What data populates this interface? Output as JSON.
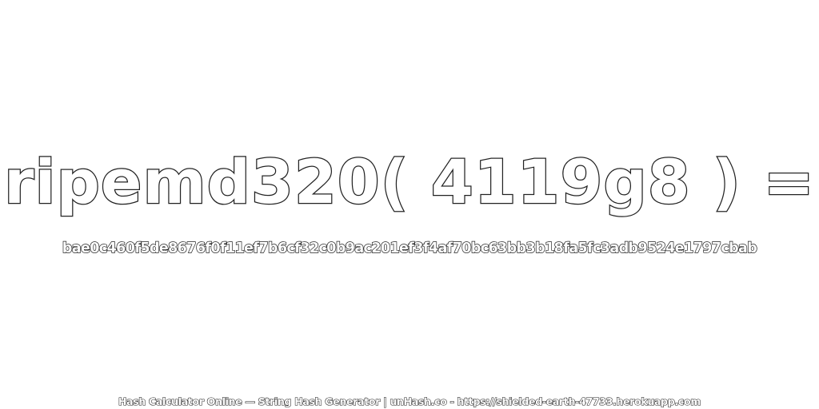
{
  "title": "ripemd320( 4119g8 ) =",
  "hash_value": "bae0c460f5de8676f0f11ef7b6cf32c0b9ac201ef3f4af70bc63bb3b18fa5fc3adb9524e1797cbab",
  "footer": "Hash Calculator Online — String Hash Generator | unHash.co - https://shielded-earth-47733.herokuapp.com",
  "colors": {
    "background": "#ffffff",
    "text_fill": "#ffffff",
    "text_outline": "#222222"
  }
}
